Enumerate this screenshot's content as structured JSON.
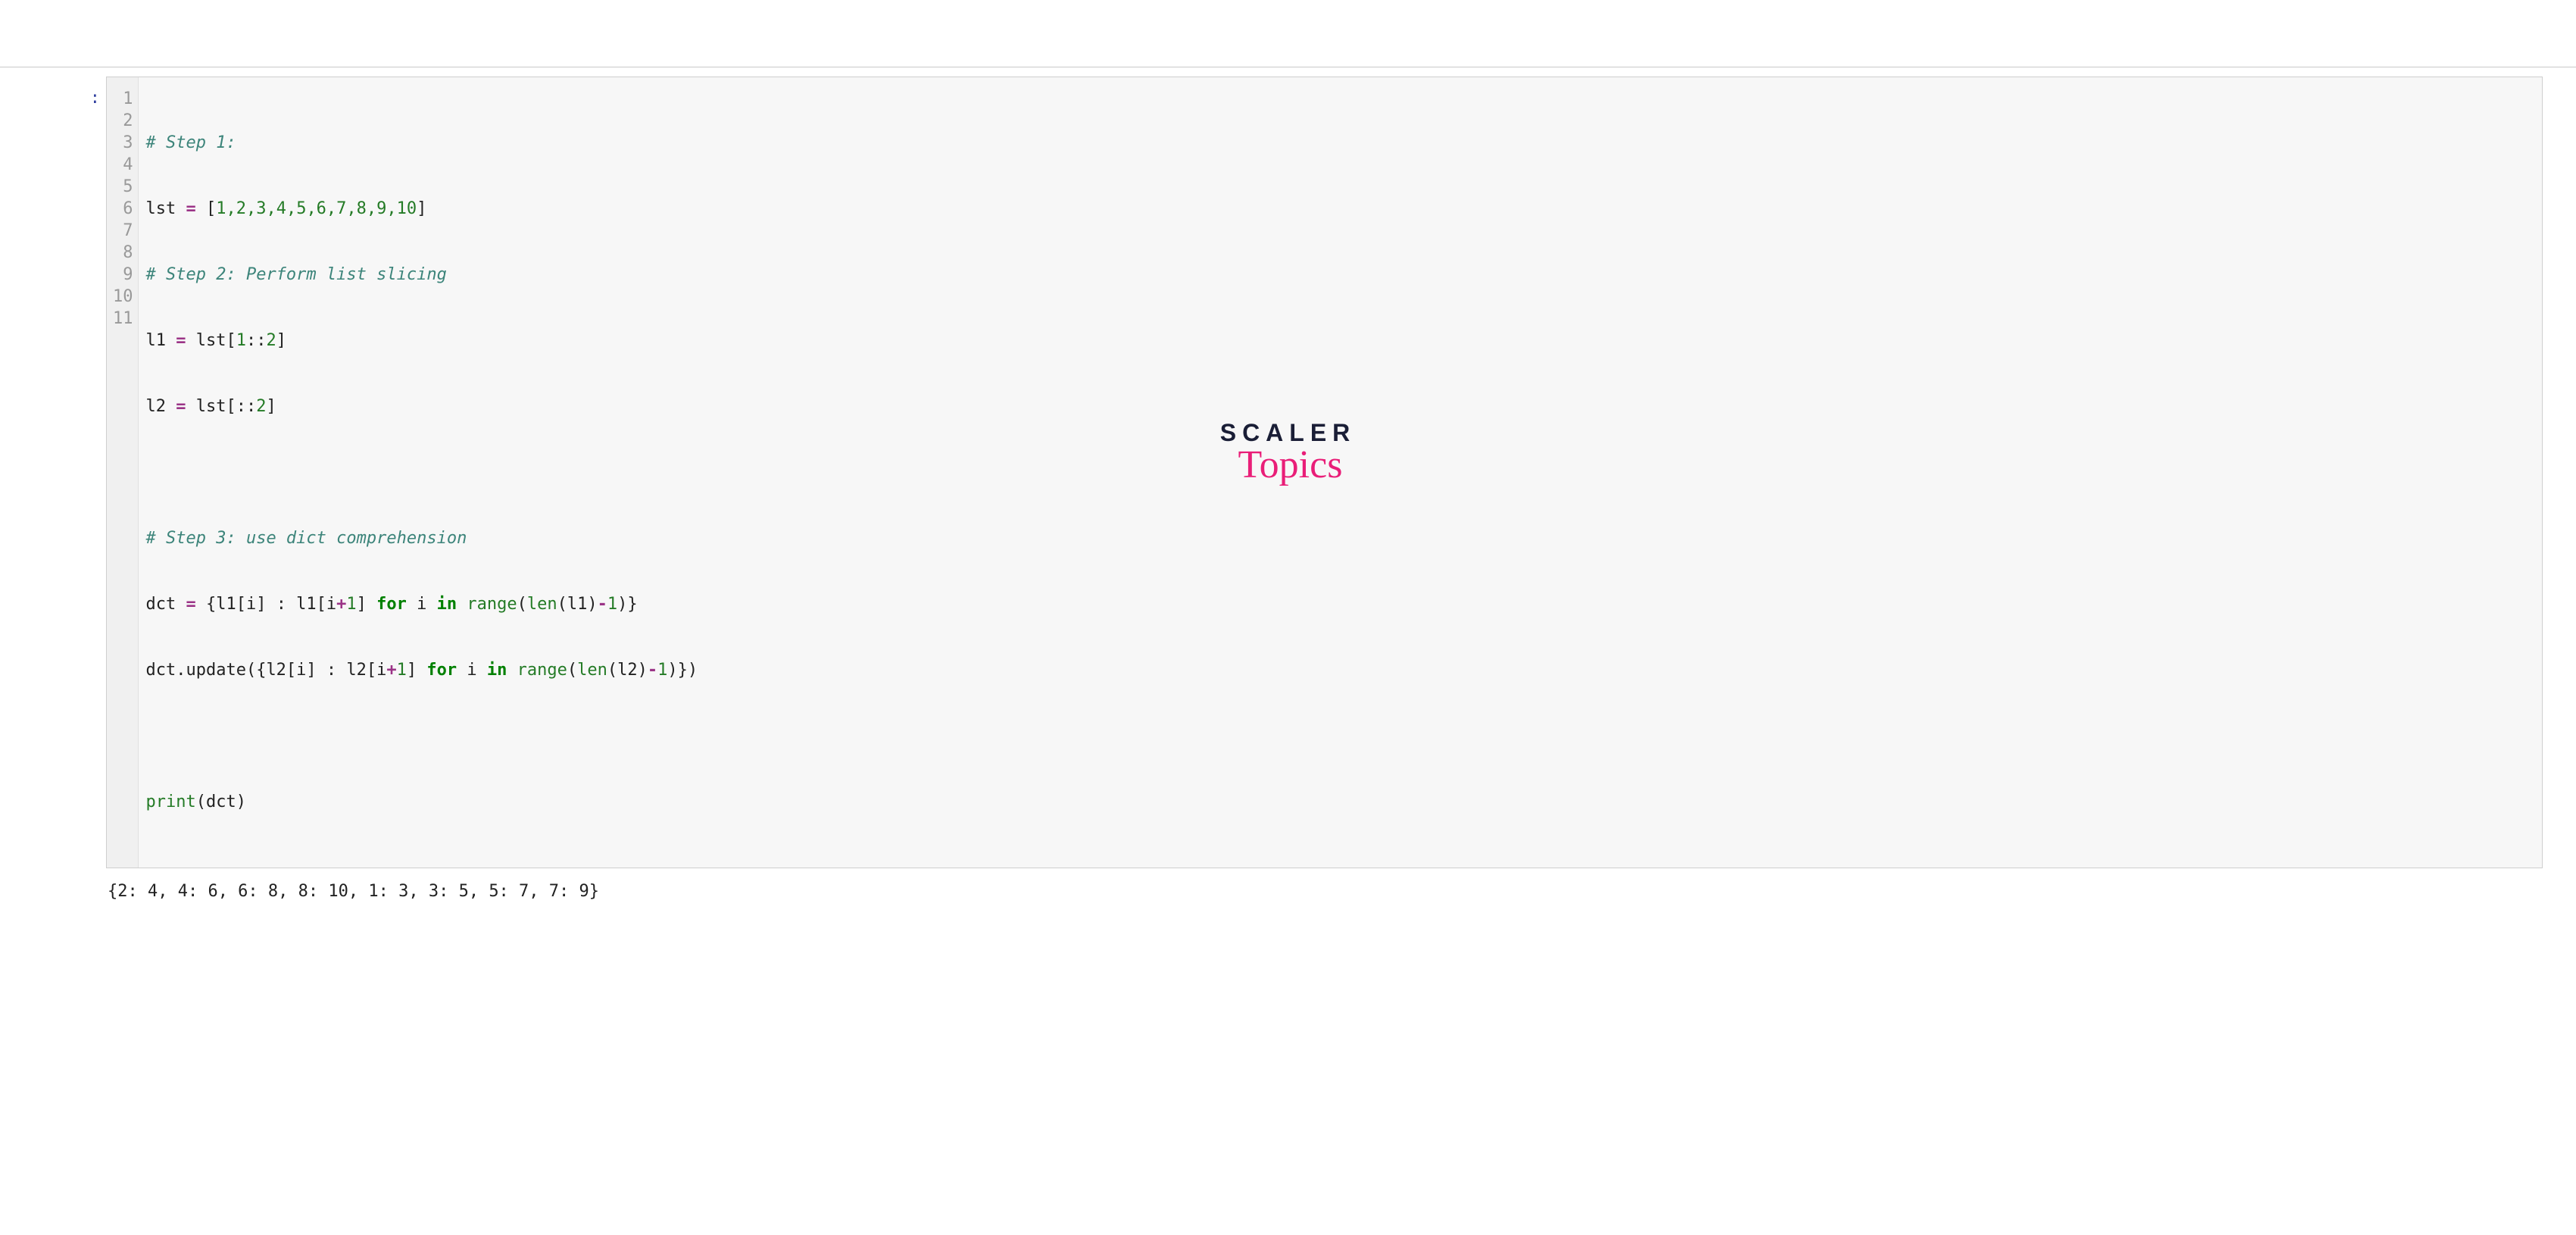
{
  "prompt": ":",
  "gutter": [
    "1",
    "2",
    "3",
    "4",
    "5",
    "6",
    "7",
    "8",
    "9",
    "10",
    "11"
  ],
  "code": {
    "l1_comment": "# Step 1:",
    "l2_a": "lst ",
    "l2_eq": "=",
    "l2_b": " [",
    "l2_nums": "1,2,3,4,5,6,7,8,9,10",
    "l2_c": "]",
    "l3_comment": "# Step 2: Perform list slicing",
    "l4_a": "l1 ",
    "l4_eq": "=",
    "l4_b": " lst[",
    "l4_n": "1",
    "l4_c": "::",
    "l4_n2": "2",
    "l4_d": "]",
    "l5_a": "l2 ",
    "l5_eq": "=",
    "l5_b": " lst[::",
    "l5_n": "2",
    "l5_c": "]",
    "l7_comment": "# Step 3: use dict comprehension",
    "l8_a": "dct ",
    "l8_eq": "=",
    "l8_b": " {l1[i] : l1[i",
    "l8_plus": "+",
    "l8_n1": "1",
    "l8_c": "] ",
    "l8_for": "for",
    "l8_d": " i ",
    "l8_in": "in",
    "l8_e": " ",
    "l8_range": "range",
    "l8_f": "(",
    "l8_len": "len",
    "l8_g": "(l1)",
    "l8_minus": "-",
    "l8_n2": "1",
    "l8_h": ")}",
    "l9_a": "dct.update({l2[i] : l2[i",
    "l9_plus": "+",
    "l9_n1": "1",
    "l9_b": "] ",
    "l9_for": "for",
    "l9_c": " i ",
    "l9_in": "in",
    "l9_d": " ",
    "l9_range": "range",
    "l9_e": "(",
    "l9_len": "len",
    "l9_f": "(l2)",
    "l9_minus": "-",
    "l9_n2": "1",
    "l9_g": ")})",
    "l11_print": "print",
    "l11_a": "(dct)"
  },
  "output": "{2: 4, 4: 6, 6: 8, 8: 10, 1: 3, 3: 5, 5: 7, 7: 9}",
  "logo": {
    "line1": "SCALER",
    "line2": "Topics"
  }
}
